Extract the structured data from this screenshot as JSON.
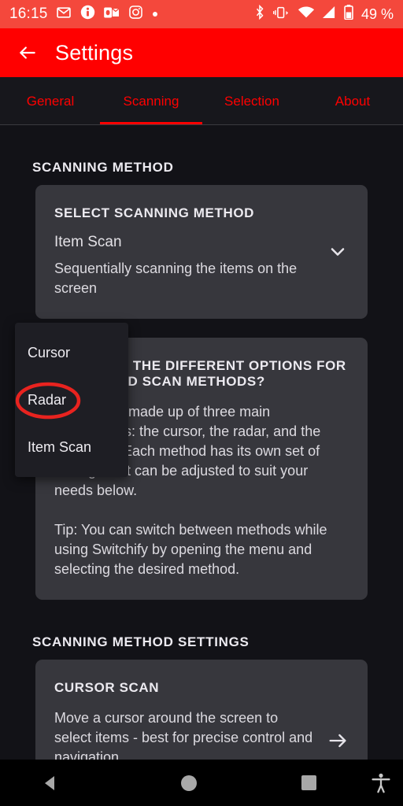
{
  "status_bar": {
    "clock": "16:15",
    "battery_text": "49 %",
    "left_icons": [
      "mail-icon",
      "person-info-icon",
      "outlook-icon",
      "instagram-icon",
      "dot-icon"
    ],
    "right_icons": [
      "bluetooth-icon",
      "vibrate-icon",
      "wifi-icon",
      "signal-icon",
      "battery-icon"
    ],
    "background_color": "#f4483c"
  },
  "app_bar": {
    "title": "Settings",
    "back_icon": "arrow-left-icon",
    "background_color": "#ff0000"
  },
  "tabs": {
    "active_index": 1,
    "accent_color": "#ff0000",
    "items": [
      {
        "label": "General"
      },
      {
        "label": "Scanning"
      },
      {
        "label": "Selection"
      },
      {
        "label": "About"
      }
    ]
  },
  "sections": [
    {
      "header": "SCANNING METHOD",
      "card": {
        "title": "SELECT SCANNING METHOD",
        "value": "Item Scan",
        "description": "Sequentially scanning the items on the screen",
        "trailing_icon": "chevron-down-icon"
      }
    },
    {
      "info_card": {
        "title": "WHAT ARE THE DIFFERENT OPTIONS FOR TIMING AND SCAN METHODS?",
        "paragraphs": [
          "Switchify is made up of three main components: the cursor, the radar, and the item scan. Each method has its own set of settings that can be adjusted to suit your needs below.",
          "Tip: You can switch between methods while using Switchify by opening the menu and selecting the desired method."
        ]
      }
    },
    {
      "header": "SCANNING METHOD SETTINGS",
      "card": {
        "title": "CURSOR SCAN",
        "description": "Move a cursor around the screen to select items - best for precise control and navigation",
        "trailing_icon": "arrow-right-icon"
      }
    }
  ],
  "dropdown_menu": {
    "visible": true,
    "items": [
      {
        "label": "Cursor"
      },
      {
        "label": "Radar"
      },
      {
        "label": "Item Scan"
      }
    ],
    "background_color": "#1e1e24"
  },
  "annotation": {
    "shape": "ellipse",
    "color": "#e8231f",
    "targets_label": "Radar"
  },
  "nav_bar": {
    "buttons": [
      {
        "icon": "back-triangle-icon"
      },
      {
        "icon": "home-circle-icon"
      },
      {
        "icon": "recents-square-icon"
      },
      {
        "icon": "accessibility-icon"
      }
    ],
    "background_color": "#000000"
  }
}
